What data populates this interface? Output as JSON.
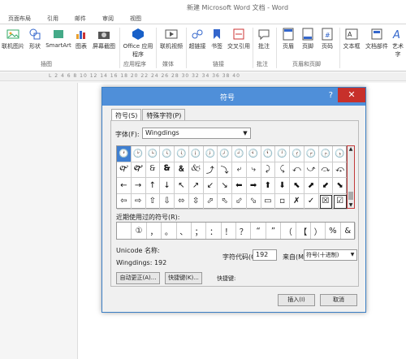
{
  "window": {
    "title": "新建 Microsoft Word 文档 - Word"
  },
  "menu_tabs": [
    "页面布局",
    "引用",
    "邮件",
    "审阅",
    "视图"
  ],
  "ribbon": {
    "buttons": [
      "联机图片",
      "形状",
      "SmartArt",
      "图表",
      "屏幕截图",
      "Office\n应用程序",
      "联机视频",
      "超链接",
      "书签",
      "交叉引用",
      "批注",
      "页眉",
      "页脚",
      "页码",
      "文本框",
      "文档部件",
      "艺术字"
    ],
    "groups": [
      "插图",
      "应用程序",
      "媒体",
      "链接",
      "批注",
      "页眉和页脚"
    ]
  },
  "ruler": {
    "numbers": "L 2 4 6 8 10 12 14 16 18 20 22 24 26 28 30 32 34 36 38 40"
  },
  "dialog": {
    "title": "符号",
    "help": "?",
    "close": "✕",
    "tabs": [
      "符号(S)",
      "特殊字符(P)"
    ],
    "font_label": "字体(F):",
    "font_value": "Wingdings",
    "recent_label": "近期使用过的符号(R):",
    "recent_symbols": [
      "",
      "①",
      "，",
      "。",
      "、",
      "；",
      "：",
      "！",
      "？",
      "“",
      "”",
      "（",
      "【",
      "）",
      "%",
      "&"
    ],
    "unicode_name_label": "Unicode 名称:",
    "char_name": "Wingdings: 192",
    "char_code_label": "字符代码(C):",
    "char_code_value": "192",
    "from_label": "来自(M):",
    "from_value": "符号(十进制)",
    "autocorrect_button": "自动更正(A)...",
    "shortcut_button": "快捷键(K)...",
    "shortcut_label": "快捷键:",
    "insert_button": "插入(I)",
    "cancel_button": "取消"
  },
  "symbol_grid": [
    [
      "🕐",
      "🕑",
      "🕒",
      "🕓",
      "🕔",
      "🕕",
      "🕖",
      "🕗",
      "🕘",
      "🕙",
      "🕚",
      "🕛",
      "🕜",
      "🕝",
      "🕞",
      "🕟"
    ],
    [
      "🙰",
      "🙱",
      "🙲",
      "🙳",
      "🙴",
      "🙵",
      "⤴",
      "⤵",
      "⤶",
      "⤷",
      "⤸",
      "⤹",
      "⤺",
      "⤻",
      "⤼",
      "⤽"
    ],
    [
      "←",
      "→",
      "↑",
      "↓",
      "↖",
      "↗",
      "↙",
      "↘",
      "⬅",
      "➡",
      "⬆",
      "⬇",
      "⬉",
      "⬈",
      "⬋",
      "⬊"
    ],
    [
      "⇦",
      "⇨",
      "⇧",
      "⇩",
      "⬄",
      "⇳",
      "⬀",
      "⬁",
      "⬃",
      "⬂",
      "▭",
      "▫",
      "✗",
      "✓",
      "☒",
      "☑"
    ]
  ],
  "colors": {
    "dialog_title": "#4f8fd9",
    "close_button": "#c7302b",
    "selected_cell": "#3f7fd1",
    "annotation_arrow": "#d42626"
  }
}
